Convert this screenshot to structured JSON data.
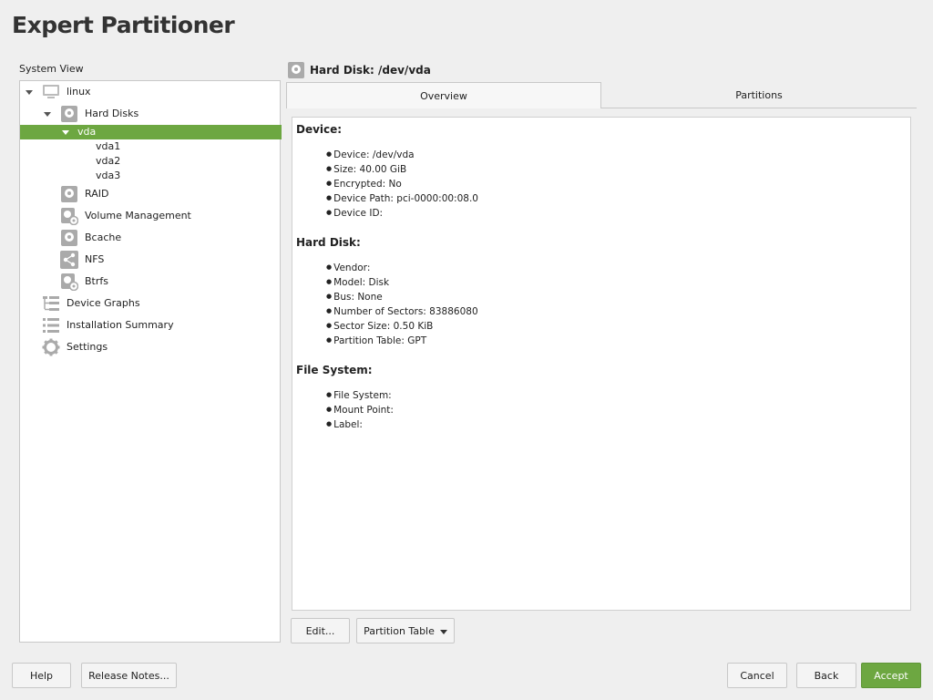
{
  "app": {
    "title": "Expert Partitioner"
  },
  "system_view": {
    "label": "System View",
    "tree": [
      {
        "label": "linux",
        "icon": "computer-icon"
      },
      {
        "label": "Hard Disks",
        "icon": "hard-disk-icon"
      },
      {
        "label": "vda",
        "selected": true
      },
      {
        "label": "vda1"
      },
      {
        "label": "vda2"
      },
      {
        "label": "vda3"
      },
      {
        "label": "RAID",
        "icon": "hard-disk-icon"
      },
      {
        "label": "Volume Management",
        "icon": "volume-management-icon"
      },
      {
        "label": "Bcache",
        "icon": "hard-disk-icon"
      },
      {
        "label": "NFS",
        "icon": "share-icon"
      },
      {
        "label": "Btrfs",
        "icon": "btrfs-icon"
      },
      {
        "label": "Device Graphs",
        "icon": "device-graph-icon"
      },
      {
        "label": "Installation Summary",
        "icon": "list-icon"
      },
      {
        "label": "Settings",
        "icon": "gear-icon"
      }
    ]
  },
  "detail": {
    "title": "Hard Disk: /dev/vda",
    "tabs": [
      {
        "label": "Overview",
        "active": true
      },
      {
        "label": "Partitions",
        "active": false
      }
    ],
    "sections": [
      {
        "heading": "Device:",
        "items": [
          "Device: /dev/vda",
          "Size: 40.00 GiB",
          "Encrypted: No",
          "Device Path: pci-0000:00:08.0",
          "Device ID:"
        ]
      },
      {
        "heading": "Hard Disk:",
        "items": [
          "Vendor:",
          "Model: Disk",
          "Bus: None",
          "Number of Sectors: 83886080",
          "Sector Size: 0.50 KiB",
          "Partition Table: GPT"
        ]
      },
      {
        "heading": "File System:",
        "items": [
          "File System:",
          "Mount Point:",
          "Label:"
        ]
      }
    ],
    "buttons": {
      "edit": "Edit...",
      "partition_table": "Partition Table"
    }
  },
  "footer": {
    "help": "Help",
    "release_notes": "Release Notes...",
    "cancel": "Cancel",
    "back": "Back",
    "accept": "Accept"
  },
  "colors": {
    "accent": "#6da741"
  }
}
